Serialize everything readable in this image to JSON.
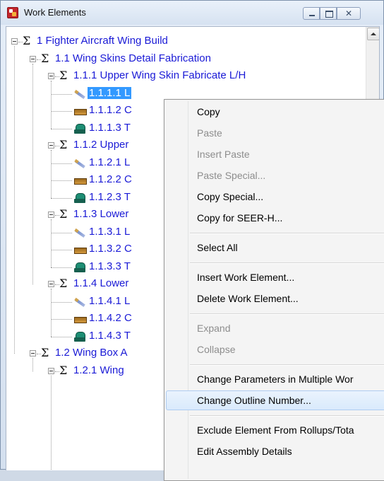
{
  "window": {
    "title": "Work Elements",
    "icon": "app-icon",
    "close_glyph": "✕"
  },
  "tree": {
    "nodes": [
      {
        "label": "1 Fighter Aircraft Wing Build",
        "level": 0,
        "kind": "assembly"
      },
      {
        "label": "1.1 Wing Skins Detail Fabrication",
        "level": 1,
        "kind": "assembly"
      },
      {
        "label": "1.1.1 Upper Wing Skin Fabricate L/H",
        "level": 2,
        "kind": "assembly"
      },
      {
        "label": "1.1.1.1 L",
        "level": 3,
        "kind": "pencil-icon",
        "selected": true
      },
      {
        "label": "1.1.1.2 C",
        "level": 3,
        "kind": "bar-icon"
      },
      {
        "label": "1.1.1.3 T",
        "level": 3,
        "kind": "tool-icon"
      },
      {
        "label": "1.1.2 Upper",
        "level": 2,
        "kind": "assembly"
      },
      {
        "label": "1.1.2.1 L",
        "level": 3,
        "kind": "pencil-icon"
      },
      {
        "label": "1.1.2.2 C",
        "level": 3,
        "kind": "bar-icon"
      },
      {
        "label": "1.1.2.3 T",
        "level": 3,
        "kind": "tool-icon"
      },
      {
        "label": "1.1.3 Lower",
        "level": 2,
        "kind": "assembly"
      },
      {
        "label": "1.1.3.1 L",
        "level": 3,
        "kind": "pencil-icon"
      },
      {
        "label": "1.1.3.2 C",
        "level": 3,
        "kind": "bar-icon"
      },
      {
        "label": "1.1.3.3 T",
        "level": 3,
        "kind": "tool-icon"
      },
      {
        "label": "1.1.4 Lower",
        "level": 2,
        "kind": "assembly"
      },
      {
        "label": "1.1.4.1 L",
        "level": 3,
        "kind": "pencil-icon"
      },
      {
        "label": "1.1.4.2 C",
        "level": 3,
        "kind": "bar-icon"
      },
      {
        "label": "1.1.4.3 T",
        "level": 3,
        "kind": "tool-icon"
      },
      {
        "label": "1.2 Wing Box A",
        "level": 1,
        "kind": "assembly"
      },
      {
        "label": "1.2.1  Wing",
        "level": 2,
        "kind": "assembly"
      }
    ]
  },
  "context_menu": {
    "items": [
      {
        "label": "Copy",
        "enabled": true
      },
      {
        "label": "Paste",
        "enabled": false
      },
      {
        "label": "Insert Paste",
        "enabled": false
      },
      {
        "label": "Paste Special...",
        "enabled": false
      },
      {
        "label": "Copy Special...",
        "enabled": true
      },
      {
        "label": "Copy for SEER-H...",
        "enabled": true
      },
      {
        "separator": true
      },
      {
        "label": "Select All",
        "enabled": true
      },
      {
        "separator": true
      },
      {
        "label": "Insert Work Element...",
        "enabled": true
      },
      {
        "label": "Delete Work Element...",
        "enabled": true
      },
      {
        "separator": true
      },
      {
        "label": "Expand",
        "enabled": false
      },
      {
        "label": "Collapse",
        "enabled": false
      },
      {
        "separator": true
      },
      {
        "label": "Change Parameters in Multiple Wor",
        "enabled": true
      },
      {
        "label": "Change Outline Number...",
        "enabled": true,
        "hover": true
      },
      {
        "separator": true
      },
      {
        "label": "Exclude Element From Rollups/Tota",
        "enabled": true
      },
      {
        "label": "Edit Assembly Details",
        "enabled": true
      }
    ]
  }
}
